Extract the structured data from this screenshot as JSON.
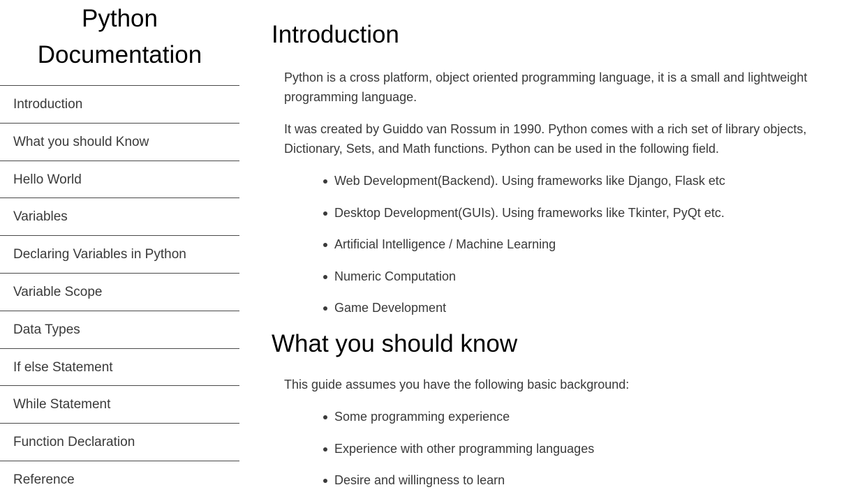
{
  "navbar": {
    "header_line1": "Python",
    "header_line2": "Documentation",
    "links": [
      "Introduction",
      "What you should Know",
      "Hello World",
      "Variables",
      "Declaring Variables in Python",
      "Variable Scope",
      "Data Types",
      "If else Statement",
      "While Statement",
      "Function Declaration",
      "Reference"
    ]
  },
  "main": {
    "introduction": {
      "title": "Introduction",
      "p1": "Python is a cross platform, object oriented programming language, it is a small and lightweight programming language.",
      "p2": "It was created by Guiddo van Rossum in 1990. Python comes with a rich set of library objects, Dictionary, Sets, and Math functions. Python can be used in the following field.",
      "items": [
        "Web Development(Backend). Using frameworks like Django, Flask etc",
        "Desktop Development(GUIs). Using frameworks like Tkinter, PyQt etc.",
        "Artificial Intelligence / Machine Learning",
        "Numeric Computation",
        "Game Development"
      ]
    },
    "what_you_should_know": {
      "title": "What you should know",
      "p1": "This guide assumes you have the following basic background:",
      "items": [
        "Some programming experience",
        "Experience with other programming languages",
        "Desire and willingness to learn"
      ]
    }
  }
}
